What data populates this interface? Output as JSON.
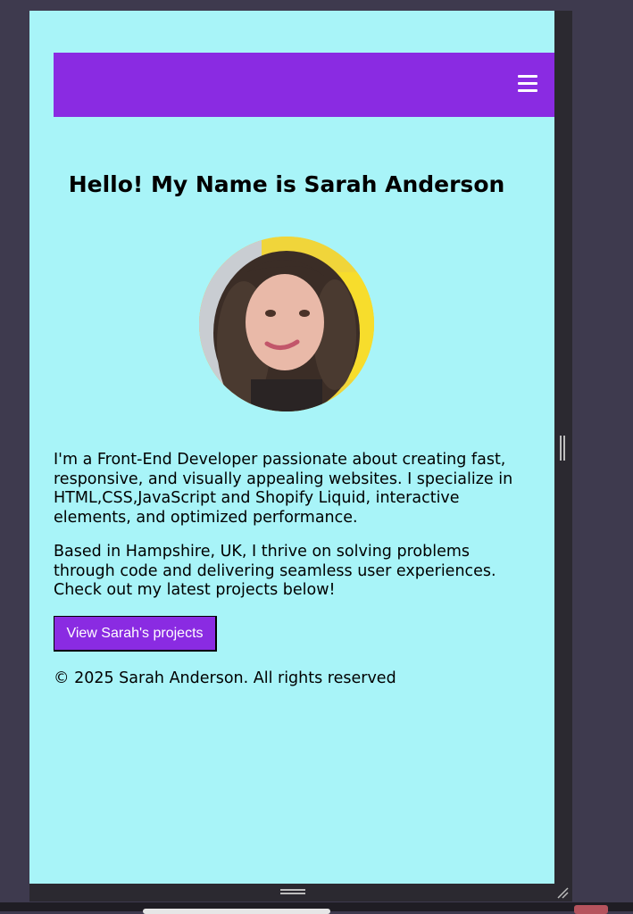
{
  "header": {
    "menu_icon": "hamburger-menu-icon"
  },
  "hero": {
    "title": "Hello! My Name is Sarah Anderson"
  },
  "profile": {
    "image_alt": "Photo of Sarah Anderson"
  },
  "about": {
    "paragraph_1": "I'm a Front-End Developer passionate about creating fast, responsive, and visually appealing websites. I specialize in HTML,CSS,JavaScript and Shopify Liquid, interactive elements, and optimized performance.",
    "paragraph_2": "Based in Hampshire, UK, I thrive on solving problems through code and delivering seamless user experiences. Check out my latest projects below!"
  },
  "cta": {
    "label": "View Sarah's projects"
  },
  "footer": {
    "text": "© 2025 Sarah Anderson. All rights reserved"
  },
  "colors": {
    "page_background": "#a8f4f8",
    "accent": "#8a2be2",
    "outer_background": "#3e3a4e"
  }
}
